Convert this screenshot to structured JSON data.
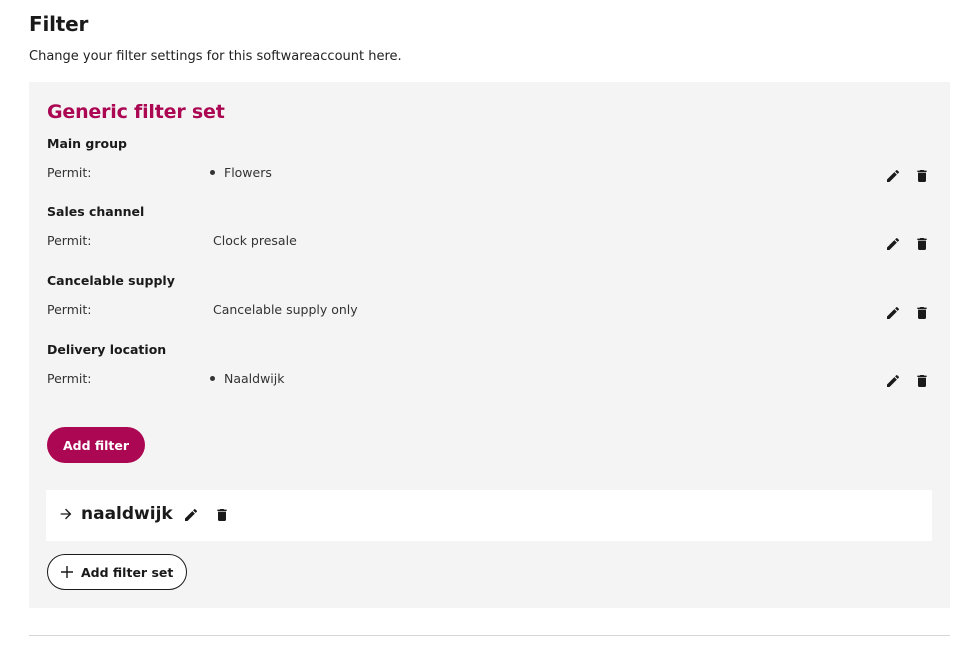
{
  "page": {
    "title": "Filter",
    "description": "Change your filter settings for this softwareaccount here."
  },
  "filter_set": {
    "title": "Generic filter set",
    "groups": [
      {
        "title": "Main group",
        "permit_label": "Permit:",
        "value": "Flowers",
        "bulleted": true
      },
      {
        "title": "Sales channel",
        "permit_label": "Permit:",
        "value": "Clock presale",
        "bulleted": false
      },
      {
        "title": "Cancelable supply",
        "permit_label": "Permit:",
        "value": "Cancelable supply only",
        "bulleted": false
      },
      {
        "title": "Delivery location",
        "permit_label": "Permit:",
        "value": "Naaldwijk",
        "bulleted": true
      }
    ],
    "add_filter_label": "Add filter"
  },
  "collapsed_set": {
    "name": "naaldwijk"
  },
  "add_filter_set_label": "Add filter set",
  "icons": {
    "edit": "pencil-icon",
    "delete": "trash-icon",
    "arrow": "arrow-right-icon",
    "add": "plus-icon"
  },
  "colors": {
    "brand": "#ab0753",
    "panel": "#f4f4f4",
    "text": "#1a1a1a"
  }
}
